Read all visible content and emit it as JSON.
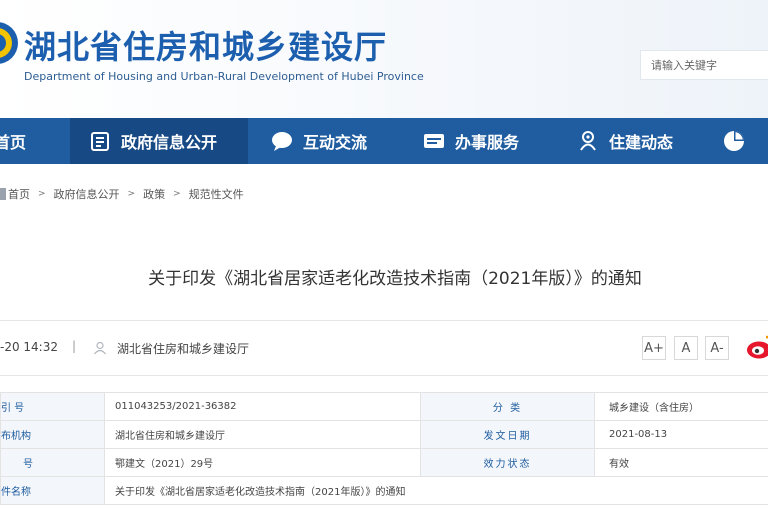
{
  "header": {
    "title": "湖北省住房和城乡建设厅",
    "subtitle": "Department of Housing and Urban-Rural Development of Hubei Province",
    "search_placeholder": "请输入关键字"
  },
  "nav": {
    "items": [
      {
        "label": "首页",
        "icon": "home-icon"
      },
      {
        "label": "政府信息公开",
        "icon": "document-icon"
      },
      {
        "label": "互动交流",
        "icon": "chat-bubble-icon"
      },
      {
        "label": "办事服务",
        "icon": "service-icon"
      },
      {
        "label": "住建动态",
        "icon": "news-icon"
      },
      {
        "label": "",
        "icon": "pie-chart-icon"
      }
    ]
  },
  "breadcrumb": {
    "items": [
      "首页",
      "政府信息公开",
      "政策",
      "规范性文件"
    ]
  },
  "article": {
    "title": "关于印发《湖北省居家适老化改造技术指南（2021年版）》的通知",
    "date": "-20 14:32",
    "pipe": "|",
    "source": "湖北省住房和城乡建设厅"
  },
  "font_controls": [
    "A+",
    "A",
    "A-"
  ],
  "info_table": {
    "rows": [
      {
        "label1": "引 号",
        "value1": "011043253/2021-36382",
        "label2": "分 类",
        "value2": "城乡建设（含住房）"
      },
      {
        "label1": "布机构",
        "value1": "湖北省住房和城乡建设厅",
        "label2": "发文日期",
        "value2": "2021-08-13"
      },
      {
        "label1": "号",
        "value1": "鄂建文（2021）29号",
        "label2": "效力状态",
        "value2": "有效"
      },
      {
        "label1": "件名称",
        "value1": "关于印发《湖北省居家适老化改造技术指南（2021年版）》的通知"
      }
    ]
  },
  "colors": {
    "brand_blue": "#1f5da0",
    "nav_active": "#174a85",
    "title_blue": "#1c5fae",
    "weibo_red": "#e6162d"
  }
}
